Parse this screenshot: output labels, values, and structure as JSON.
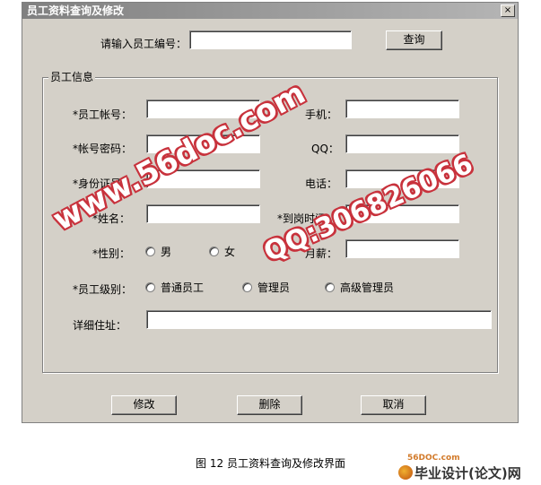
{
  "window": {
    "title": "员工资料查询及修改",
    "close_glyph": "×"
  },
  "search": {
    "label": "请输入员工编号：",
    "value": "",
    "button": "查询"
  },
  "group": {
    "title": "员工信息"
  },
  "fields": {
    "account": {
      "label": "*员工帐号：",
      "value": ""
    },
    "phone": {
      "label": "手机：",
      "value": ""
    },
    "password": {
      "label": "*帐号密码：",
      "value": ""
    },
    "qq": {
      "label": "QQ：",
      "value": ""
    },
    "idcard": {
      "label": "*身份证号：",
      "value": ""
    },
    "tel": {
      "label": "电话：",
      "value": ""
    },
    "name": {
      "label": "*姓名：",
      "value": ""
    },
    "hire_date": {
      "label": "*到岗时间：",
      "value": ""
    },
    "gender": {
      "label": "*性别：",
      "options": [
        "男",
        "女"
      ]
    },
    "salary": {
      "label": "月薪：",
      "value": ""
    },
    "level": {
      "label": "*员工级别：",
      "options": [
        "普通员工",
        "管理员",
        "高级管理员"
      ]
    },
    "address": {
      "label": "详细住址：",
      "value": ""
    }
  },
  "buttons": {
    "modify": "修改",
    "delete": "删除",
    "cancel": "取消"
  },
  "watermarks": {
    "left": "www.56doc.com",
    "right": "QQ:306826066"
  },
  "caption": "图 12  员工资料查询及修改界面",
  "footer": {
    "site_small": "56DOC.com",
    "site_name": "毕业设计(论文)网"
  },
  "colors": {
    "window_bg": "#d4d0c8",
    "titlebar": "#808080",
    "watermark": "#c8323c"
  }
}
